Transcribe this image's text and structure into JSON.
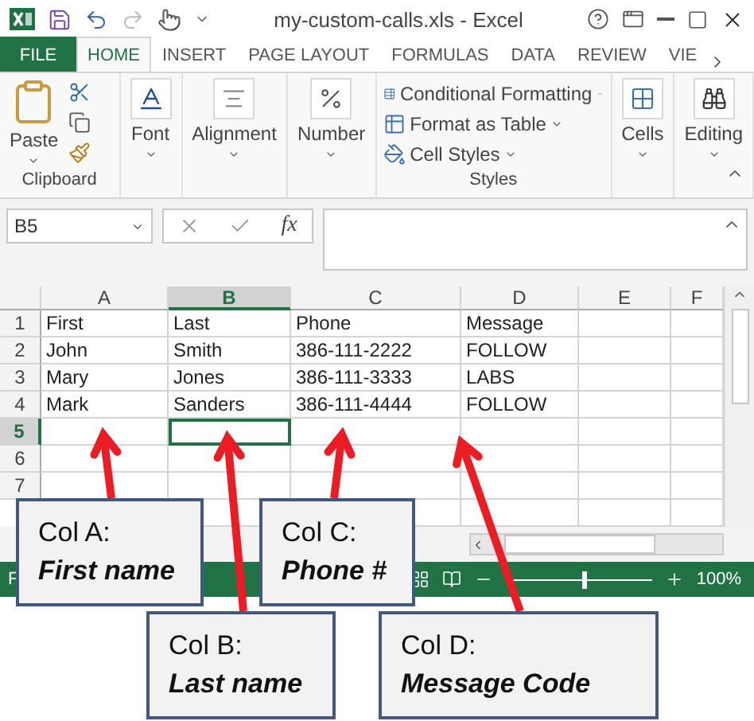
{
  "window": {
    "title": "my-custom-calls.xls - Excel"
  },
  "tabs": [
    {
      "label": "FILE",
      "kind": "file",
      "selected": false
    },
    {
      "label": "HOME",
      "kind": "tab",
      "selected": true
    },
    {
      "label": "INSERT",
      "kind": "tab",
      "selected": false
    },
    {
      "label": "PAGE LAYOUT",
      "kind": "tab",
      "selected": false
    },
    {
      "label": "FORMULAS",
      "kind": "tab",
      "selected": false
    },
    {
      "label": "DATA",
      "kind": "tab",
      "selected": false
    },
    {
      "label": "REVIEW",
      "kind": "tab",
      "selected": false
    },
    {
      "label": "VIE",
      "kind": "tab",
      "selected": false
    }
  ],
  "ribbon": {
    "groups": [
      {
        "kind": "clipboard",
        "title": "Clipboard",
        "button": "Paste"
      },
      {
        "kind": "font",
        "button": "Font"
      },
      {
        "kind": "alignment",
        "button": "Alignment"
      },
      {
        "kind": "number",
        "button": "Number"
      },
      {
        "kind": "styles",
        "title": "Styles",
        "items": [
          "Conditional Formatting",
          "Format as Table",
          "Cell Styles"
        ]
      },
      {
        "kind": "cells",
        "button": "Cells"
      },
      {
        "kind": "editing",
        "button": "Editing"
      }
    ]
  },
  "formula_bar": {
    "name_box": "B5",
    "function_label": "fx"
  },
  "sheet": {
    "columns": [
      {
        "label": "A",
        "selected": false
      },
      {
        "label": "B",
        "selected": true
      },
      {
        "label": "C",
        "selected": false
      },
      {
        "label": "D",
        "selected": false
      },
      {
        "label": "E",
        "selected": false
      },
      {
        "label": "F",
        "selected": false
      }
    ],
    "rows": [
      {
        "number": "1",
        "selected": false,
        "cells": [
          "First",
          "Last",
          "Phone",
          "Message"
        ]
      },
      {
        "number": "2",
        "selected": false,
        "cells": [
          "John",
          "Smith",
          "386-111-2222",
          "FOLLOW"
        ]
      },
      {
        "number": "3",
        "selected": false,
        "cells": [
          "Mary",
          "Jones",
          "386-111-3333",
          "LABS"
        ]
      },
      {
        "number": "4",
        "selected": false,
        "cells": [
          "Mark",
          "Sanders",
          "386-111-4444",
          "FOLLOW"
        ]
      },
      {
        "number": "5",
        "selected": true,
        "cells": []
      },
      {
        "number": "6",
        "selected": false,
        "cells": []
      },
      {
        "number": "7",
        "selected": false,
        "cells": []
      }
    ]
  },
  "status_bar": {
    "text": "F",
    "zoom": "100%",
    "level": 0.52
  },
  "callouts": [
    {
      "label": "Col A:",
      "caption": "First name"
    },
    {
      "label": "Col B:",
      "caption": "Last name"
    },
    {
      "label": "Col C:",
      "caption": "Phone #"
    },
    {
      "label": "Col D:",
      "caption": "Message Code"
    }
  ]
}
